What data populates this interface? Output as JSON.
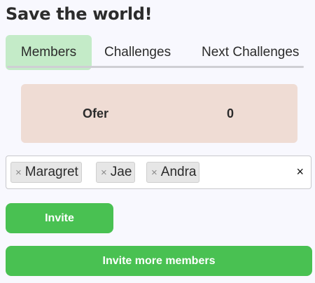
{
  "app": {
    "title": "Save the world!"
  },
  "tabs": [
    {
      "label": "Members",
      "active": true
    },
    {
      "label": "Challenges",
      "active": false
    },
    {
      "label": "Next Challenges",
      "active": false
    }
  ],
  "member": {
    "name": "Ofer",
    "score": "0"
  },
  "invite_tags": [
    {
      "label": "Maragret",
      "remove_glyph": "×"
    },
    {
      "label": "Jae",
      "remove_glyph": "×"
    },
    {
      "label": "Andra",
      "remove_glyph": "×"
    }
  ],
  "clear_glyph": "×",
  "buttons": {
    "invite": "Invite",
    "invite_more": "Invite more members"
  },
  "colors": {
    "accent_green": "#49c152",
    "active_tab_bg": "#c4ebc8",
    "member_card_bg": "#efdcd4"
  }
}
